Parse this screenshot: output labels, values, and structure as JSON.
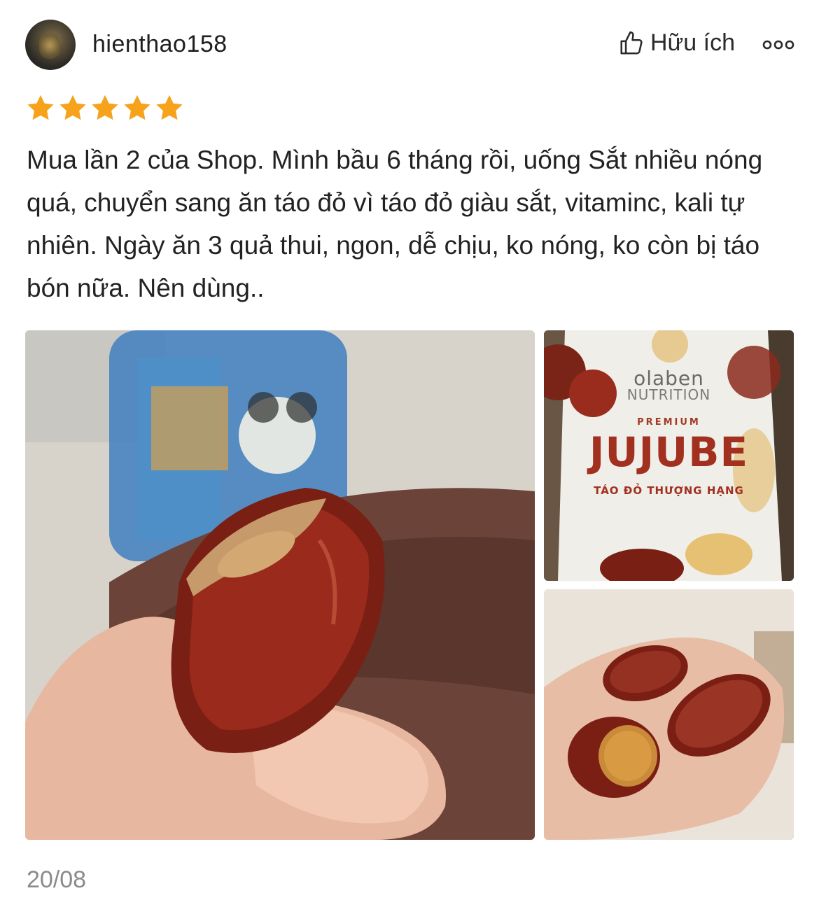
{
  "review": {
    "username": "hienthao158",
    "helpful_label": "Hữu ích",
    "rating": 5,
    "text": "Mua lần 2 của Shop. Mình bầu 6 tháng rồi, uống Sắt nhiều nóng quá, chuyển sang ăn táo đỏ vì táo đỏ giàu sắt, vitaminc, kali tự nhiên. Ngày ăn 3 quả thui, ngon, dễ chịu, ko nóng, ko còn bị táo bón nữa. Nên dùng..",
    "date": "20/08"
  },
  "colors": {
    "star": "#f7a21b",
    "text": "#222222",
    "date": "#8a8a8a"
  },
  "icons": {
    "helpful": "thumbs-up-icon",
    "more": "more-options-icon",
    "star": "star-icon"
  },
  "package": {
    "brand": "olaben",
    "brand_sub": "NUTRITION",
    "premium": "PREMIUM",
    "product": "JUJUBE",
    "product_vn": "TÁO ĐỎ THƯỢNG HẠNG"
  }
}
